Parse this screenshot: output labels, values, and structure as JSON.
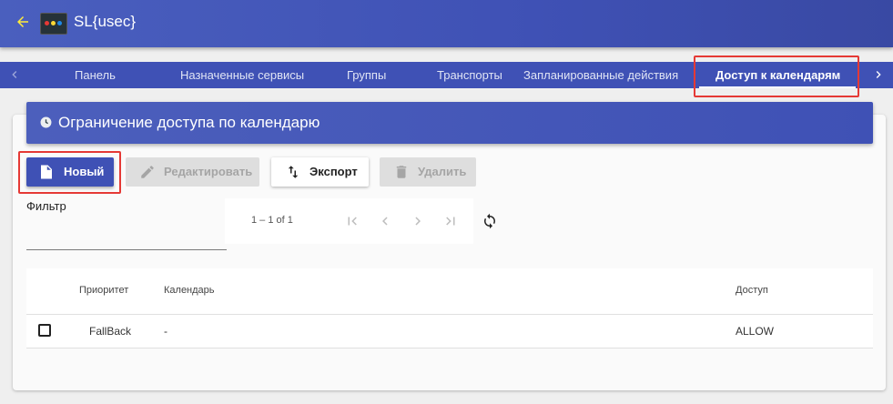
{
  "app": {
    "title": "SL{usec}",
    "accent_color": "#3f51b5",
    "back_icon": "arrow-left-icon",
    "logo_icon": "app-logo-icon"
  },
  "tabs": [
    {
      "label": "Панель",
      "active": false
    },
    {
      "label": "Назначенные сервисы",
      "active": false
    },
    {
      "label": "Группы",
      "active": false
    },
    {
      "label": "Транспорты",
      "active": false
    },
    {
      "label": "Запланированные действия",
      "active": false
    },
    {
      "label": "Доступ к календарям",
      "active": true
    }
  ],
  "card": {
    "title": "Ограничение доступа по календарю",
    "title_icon": "clock-icon"
  },
  "toolbar": {
    "new_label": "Новый",
    "edit_label": "Редактировать",
    "export_label": "Экспорт",
    "delete_label": "Удалить"
  },
  "filter": {
    "label": "Фильтр",
    "value": ""
  },
  "pager": {
    "range": "1 – 1 of 1"
  },
  "table": {
    "columns": [
      "Приоритет",
      "Календарь",
      "Доступ"
    ],
    "rows": [
      {
        "checked": false,
        "priority": "FallBack",
        "calendar": "-",
        "access": "ALLOW"
      }
    ]
  },
  "highlight_color": "#e53935"
}
